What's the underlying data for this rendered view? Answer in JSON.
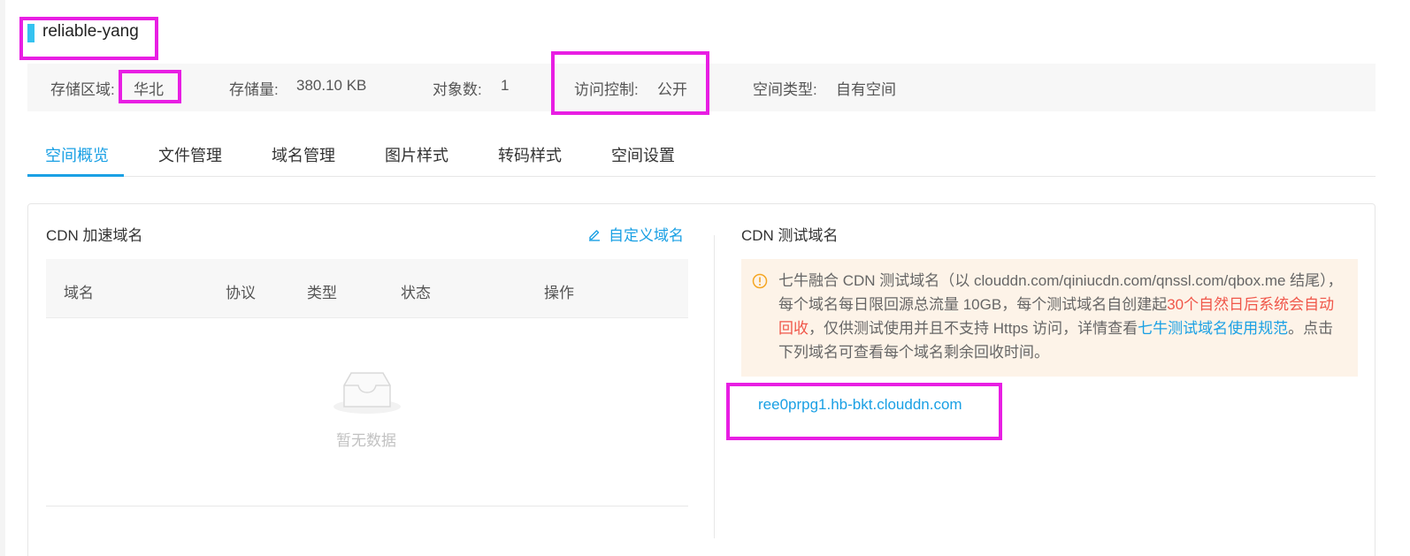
{
  "bucket": {
    "name": "reliable-yang"
  },
  "info": {
    "region_label": "存储区域:",
    "region_value": "华北",
    "storage_label": "存储量:",
    "storage_value": "380.10 KB",
    "objects_label": "对象数:",
    "objects_value": "1",
    "access_label": "访问控制:",
    "access_value": "公开",
    "type_label": "空间类型:",
    "type_value": "自有空间"
  },
  "tabs": [
    {
      "label": "空间概览",
      "active": true
    },
    {
      "label": "文件管理"
    },
    {
      "label": "域名管理"
    },
    {
      "label": "图片样式"
    },
    {
      "label": "转码样式"
    },
    {
      "label": "空间设置"
    }
  ],
  "cdn": {
    "title": "CDN 加速域名",
    "custom_domain_label": "自定义域名",
    "columns": [
      "域名",
      "协议",
      "类型",
      "状态",
      "操作"
    ],
    "empty_text": "暂无数据"
  },
  "test_domain": {
    "title": "CDN 测试域名",
    "notice_part1": "七牛融合 CDN 测试域名（以 clouddn.com/qiniucdn.com/qnssl.com/qbox.me 结尾），每个域名每日限回源总流量 10GB，每个测试域名自创建起",
    "notice_red": "30个自然日后系统会自动回收",
    "notice_part2": "，仅供测试使用并且不支持 Https 访问，详情查看",
    "notice_link": "七牛测试域名使用规范",
    "notice_part3": "。点击下列域名可查看每个域名剩余回收时间。",
    "domain": "ree0prpg1.hb-bkt.clouddn.com"
  },
  "colors": {
    "accent": "#1aa0e4",
    "highlight": "#e81ee3",
    "warning_text": "#f0574a",
    "notice_bg": "#fdf3e8"
  }
}
